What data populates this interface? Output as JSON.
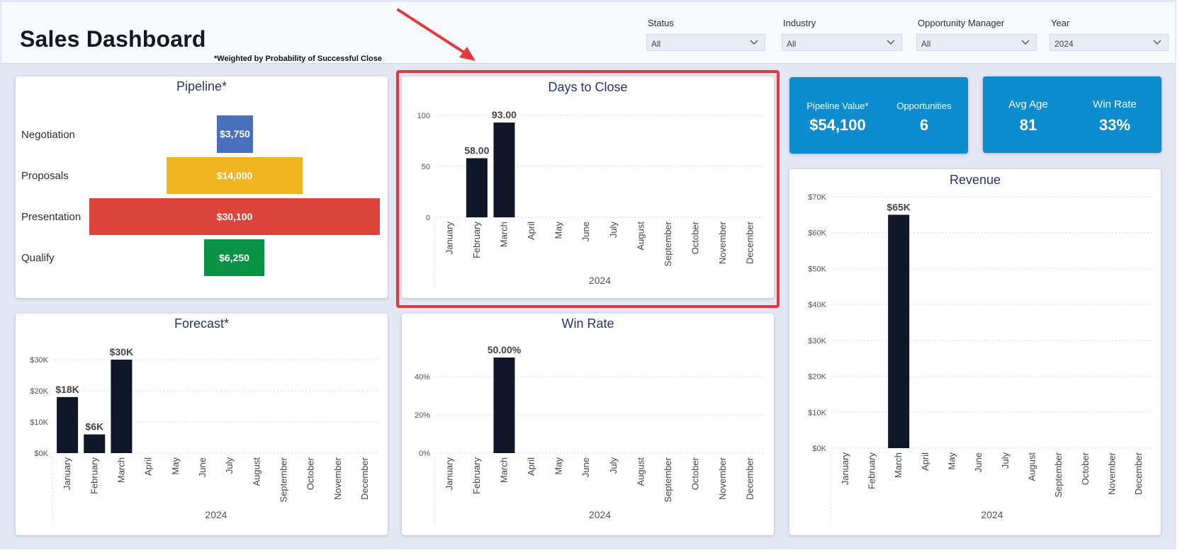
{
  "header": {
    "title": "Sales Dashboard",
    "note": "*Weighted by Probability of Successful Close",
    "filters": [
      {
        "label": "Status",
        "value": "All"
      },
      {
        "label": "Industry",
        "value": "All"
      },
      {
        "label": "Opportunity Manager",
        "value": "All"
      },
      {
        "label": "Year",
        "value": "2024"
      }
    ]
  },
  "pipeline": {
    "title": "Pipeline*",
    "stages": [
      {
        "label": "Negotiation",
        "value": "$3,750",
        "color": "#4a6fbd"
      },
      {
        "label": "Proposals",
        "value": "$14,000",
        "color": "#f0b51f"
      },
      {
        "label": "Presentation",
        "value": "$30,100",
        "color": "#dc433b"
      },
      {
        "label": "Qualify",
        "value": "$6,250",
        "color": "#0a9347"
      }
    ]
  },
  "kpi1": {
    "pipeline_label": "Pipeline Value*",
    "pipeline_value": "$54,100",
    "opp_label": "Opportunities",
    "opp_value": "6"
  },
  "kpi2": {
    "age_label": "Avg Age",
    "age_value": "81",
    "win_label": "Win Rate",
    "win_value": "33%"
  },
  "chart_data": [
    {
      "id": "days",
      "type": "bar",
      "title": "Days to Close",
      "xlabel": "2024",
      "categories": [
        "January",
        "February",
        "March",
        "April",
        "May",
        "June",
        "July",
        "August",
        "September",
        "October",
        "November",
        "December"
      ],
      "values": [
        null,
        58,
        93,
        null,
        null,
        null,
        null,
        null,
        null,
        null,
        null,
        null
      ],
      "data_labels": [
        null,
        "58.00",
        "93.00",
        null,
        null,
        null,
        null,
        null,
        null,
        null,
        null,
        null
      ],
      "yticks": [
        {
          "v": 0,
          "label": "0"
        },
        {
          "v": 50,
          "label": "50"
        },
        {
          "v": 100,
          "label": "100"
        }
      ],
      "ylim": [
        0,
        100
      ],
      "bar_color": "#0f1729",
      "grid": true
    },
    {
      "id": "forecast",
      "type": "bar",
      "title": "Forecast*",
      "xlabel": "2024",
      "categories": [
        "January",
        "February",
        "March",
        "April",
        "May",
        "June",
        "July",
        "August",
        "September",
        "October",
        "November",
        "December"
      ],
      "values": [
        18000,
        6000,
        30000,
        null,
        null,
        null,
        null,
        null,
        null,
        null,
        null,
        null
      ],
      "data_labels": [
        "$18K",
        "$6K",
        "$30K",
        null,
        null,
        null,
        null,
        null,
        null,
        null,
        null,
        null
      ],
      "yticks": [
        {
          "v": 0,
          "label": "$0K"
        },
        {
          "v": 10000,
          "label": "$10K"
        },
        {
          "v": 20000,
          "label": "$20K"
        },
        {
          "v": 30000,
          "label": "$30K"
        }
      ],
      "ylim": [
        0,
        30000
      ],
      "bar_color": "#0f1729",
      "grid": true
    },
    {
      "id": "winrate",
      "type": "bar",
      "title": "Win Rate",
      "xlabel": "2024",
      "categories": [
        "January",
        "February",
        "March",
        "April",
        "May",
        "June",
        "July",
        "August",
        "September",
        "October",
        "November",
        "December"
      ],
      "values": [
        null,
        null,
        50,
        null,
        null,
        null,
        null,
        null,
        null,
        null,
        null,
        null
      ],
      "data_labels": [
        null,
        null,
        "50.00%",
        null,
        null,
        null,
        null,
        null,
        null,
        null,
        null,
        null
      ],
      "yticks": [
        {
          "v": 0,
          "label": "0%"
        },
        {
          "v": 20,
          "label": "20%"
        },
        {
          "v": 40,
          "label": "40%"
        }
      ],
      "ylim": [
        0,
        50
      ],
      "bar_color": "#0f1729",
      "grid": true
    },
    {
      "id": "revenue",
      "type": "bar",
      "title": "Revenue",
      "xlabel": "2024",
      "categories": [
        "January",
        "February",
        "March",
        "April",
        "May",
        "June",
        "July",
        "August",
        "September",
        "October",
        "November",
        "December"
      ],
      "values": [
        null,
        null,
        65000,
        null,
        null,
        null,
        null,
        null,
        null,
        null,
        null,
        null
      ],
      "data_labels": [
        null,
        null,
        "$65K",
        null,
        null,
        null,
        null,
        null,
        null,
        null,
        null,
        null
      ],
      "yticks": [
        {
          "v": 0,
          "label": "$0K"
        },
        {
          "v": 10000,
          "label": "$10K"
        },
        {
          "v": 20000,
          "label": "$20K"
        },
        {
          "v": 30000,
          "label": "$30K"
        },
        {
          "v": 40000,
          "label": "$40K"
        },
        {
          "v": 50000,
          "label": "$50K"
        },
        {
          "v": 60000,
          "label": "$60K"
        },
        {
          "v": 70000,
          "label": "$70K"
        }
      ],
      "ylim": [
        0,
        70000
      ],
      "bar_color": "#0f1729",
      "grid": true
    }
  ]
}
